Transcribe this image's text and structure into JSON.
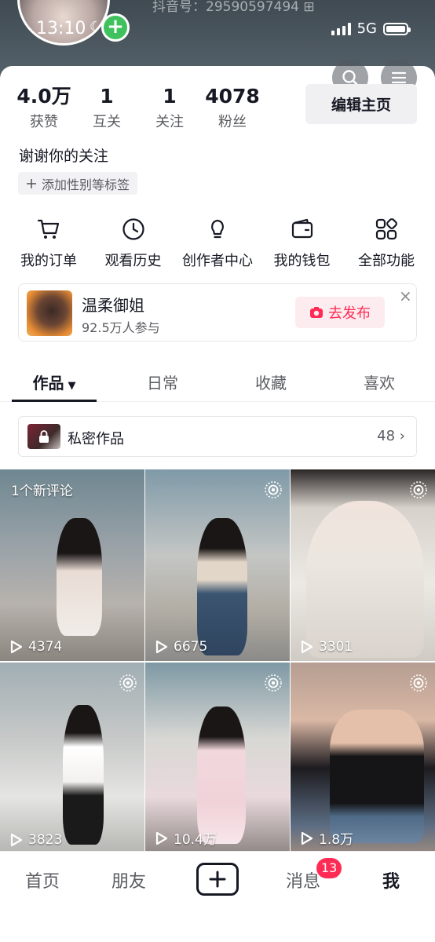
{
  "status_bar": {
    "time": "13:10",
    "moon": "☾",
    "network": "5G",
    "douyin_id": "抖音号：29590597494 ⊞"
  },
  "header": {
    "search_icon": "search-icon",
    "menu_icon": "menu-icon"
  },
  "stats": [
    {
      "value": "4.0万",
      "label": "获赞"
    },
    {
      "value": "1",
      "label": "互关"
    },
    {
      "value": "1",
      "label": "关注"
    },
    {
      "value": "4078",
      "label": "粉丝"
    }
  ],
  "edit_profile_label": "编辑主页",
  "bio": "谢谢你的关注",
  "add_tag_label": "添加性别等标签",
  "quick_actions": [
    {
      "label": "我的订单",
      "icon": "cart-icon"
    },
    {
      "label": "观看历史",
      "icon": "clock-icon"
    },
    {
      "label": "创作者中心",
      "icon": "lightbulb-icon"
    },
    {
      "label": "我的钱包",
      "icon": "wallet-icon"
    },
    {
      "label": "全部功能",
      "icon": "grid-icon"
    }
  ],
  "promo": {
    "title": "温柔御姐",
    "subtitle": "92.5万人参与",
    "button_label": "去发布",
    "close": "×"
  },
  "tabs": [
    {
      "label": "作品",
      "active": true,
      "caret": "▼"
    },
    {
      "label": "日常",
      "active": false
    },
    {
      "label": "收藏",
      "active": false
    },
    {
      "label": "喜欢",
      "active": false
    }
  ],
  "private_works": {
    "label": "私密作品",
    "count": "48 ›"
  },
  "videos": [
    {
      "plays": "4374",
      "badge": "1个新评论",
      "live": false
    },
    {
      "plays": "6675",
      "live": true
    },
    {
      "plays": "3301",
      "live": true
    },
    {
      "plays": "3823",
      "live": true
    },
    {
      "plays": "10.4万",
      "live": true
    },
    {
      "plays": "1.8万",
      "live": true
    }
  ],
  "bottom_nav": {
    "home": "首页",
    "friends": "朋友",
    "messages": "消息",
    "messages_badge": "13",
    "me": "我"
  },
  "colors": {
    "accent": "#fe2c55",
    "text": "#161823",
    "secondary": "#5b5c61",
    "plus_green": "#3fc25e"
  }
}
